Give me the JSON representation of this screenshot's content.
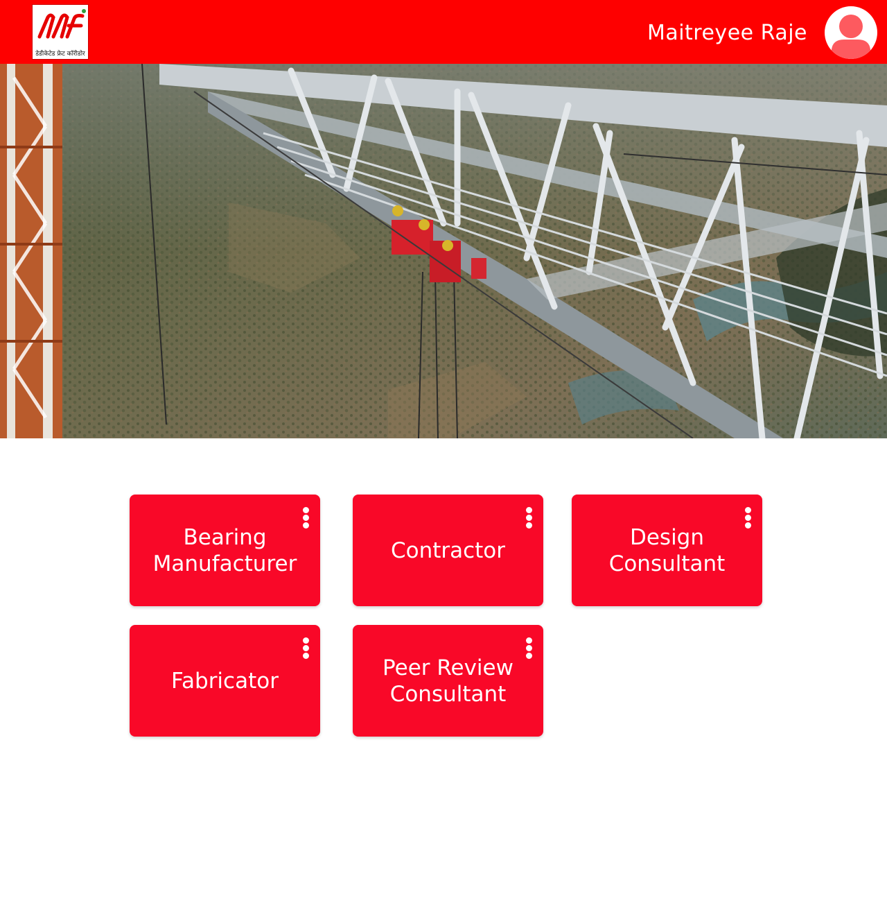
{
  "header": {
    "logo_caption": "डेडीकेटेड फ्रेट कॉरीडोर",
    "user_name": "Maitreyee Raje",
    "background_color": "#fe0000"
  },
  "cards": [
    {
      "label": "Bearing\nManufacturer"
    },
    {
      "label": "Contractor"
    },
    {
      "label": "Design\nConsultant"
    },
    {
      "label": "Fabricator"
    },
    {
      "label": "Peer Review\nConsultant"
    }
  ],
  "colors": {
    "card": "#f90828",
    "accent": "#fe0000"
  }
}
